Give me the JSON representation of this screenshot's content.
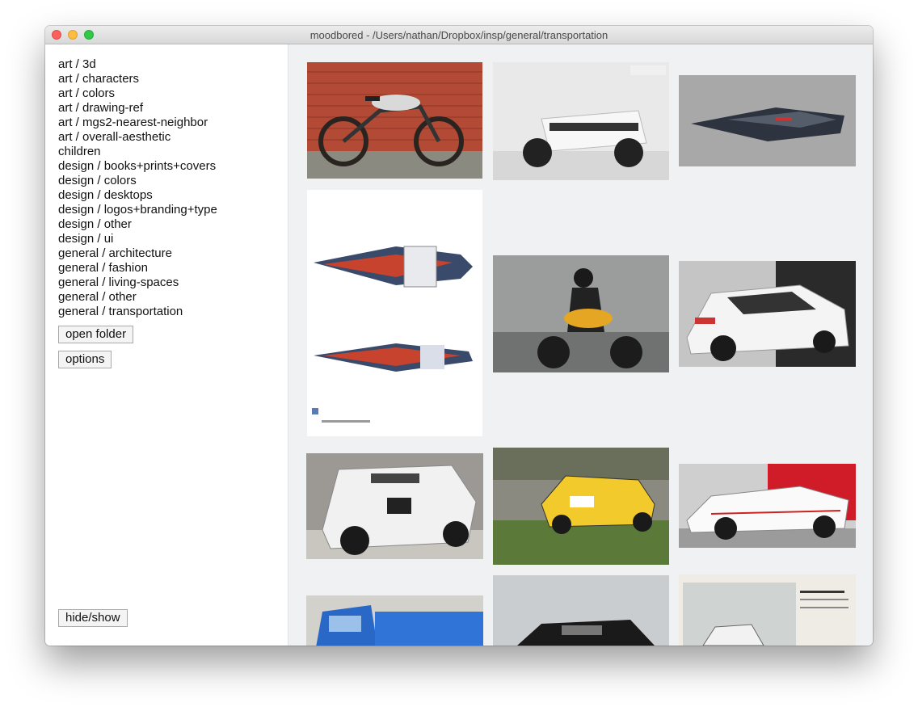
{
  "window": {
    "title": "moodbored - /Users/nathan/Dropbox/insp/general/transportation"
  },
  "sidebar": {
    "folders": [
      "art / 3d",
      "art / characters",
      "art / colors",
      "art / drawing-ref",
      "art / mgs2-nearest-neighbor",
      "art / overall-aesthetic",
      "children",
      "design / books+prints+covers",
      "design / colors",
      "design / desktops",
      "design / logos+branding+type",
      "design / other",
      "design / ui",
      "general / architecture",
      "general / fashion",
      "general / living-spaces",
      "general / other",
      "general / transportation"
    ],
    "open_folder_label": "open folder",
    "options_label": "options",
    "hide_show_label": "hide/show"
  },
  "gallery": {
    "images": [
      {
        "id": "cafe-racer-moped"
      },
      {
        "id": "white-scooter"
      },
      {
        "id": "spaceship-render"
      },
      {
        "id": "spaceship-blueprint"
      },
      {
        "id": "rider-on-yellow-motorcycle"
      },
      {
        "id": "white-toyota-rally-car-front"
      },
      {
        "id": "white-toyota-rally-car-rear"
      },
      {
        "id": "audi-rally-car"
      },
      {
        "id": "ford-rs200"
      },
      {
        "id": "blue-truck"
      },
      {
        "id": "black-hatchback"
      },
      {
        "id": "lada-niva-print"
      }
    ]
  },
  "colors": {
    "sidebar_bg": "#ffffff",
    "content_bg": "#f0f1f3",
    "close": "#fc605c",
    "minimize": "#fdbc40",
    "zoom": "#34c84a"
  }
}
